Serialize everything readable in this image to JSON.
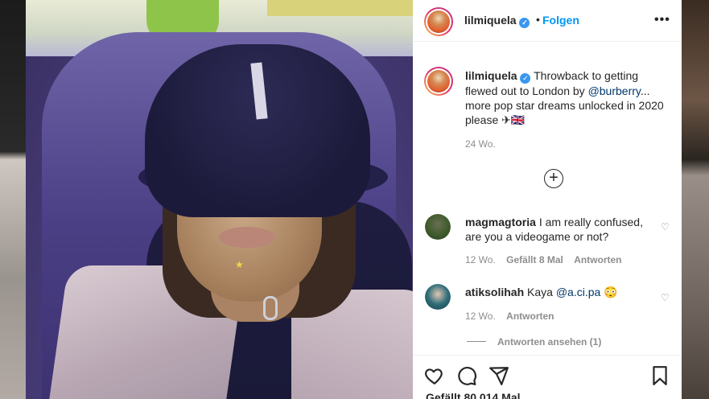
{
  "post": {
    "username": "lilmiquela",
    "verified_mark": "✓",
    "separator": "•",
    "follow_label": "Folgen",
    "more_label": "•••"
  },
  "caption": {
    "username": "lilmiquela",
    "text_before": "Throwback to getting flewed out to London by ",
    "mention": "@burberry",
    "text_after": "... more pop star dreams unlocked in 2020 please ✈🇬🇧",
    "age": "24 Wo."
  },
  "load_more_label": "+",
  "comments": [
    {
      "username": "magmagtoria",
      "text": "I am really confused, are you a videogame or not?",
      "age": "12 Wo.",
      "likes": "Gefällt 8 Mal",
      "reply": "Antworten"
    },
    {
      "username": "atiksolihah",
      "text_before": "Kaya ",
      "mention": "@a.ci.pa",
      "emoji": "😳",
      "age": "12 Wo.",
      "reply": "Antworten"
    }
  ],
  "view_replies_label": "Antworten ansehen (1)",
  "likes_count": "Gefällt 80.014 Mal",
  "icons": [
    "heart-icon",
    "comment-icon",
    "share-icon",
    "bookmark-icon",
    "more-icon"
  ],
  "colors": {
    "link": "#0095f6",
    "verified": "#3897f0",
    "muted": "#8e8e8e"
  }
}
